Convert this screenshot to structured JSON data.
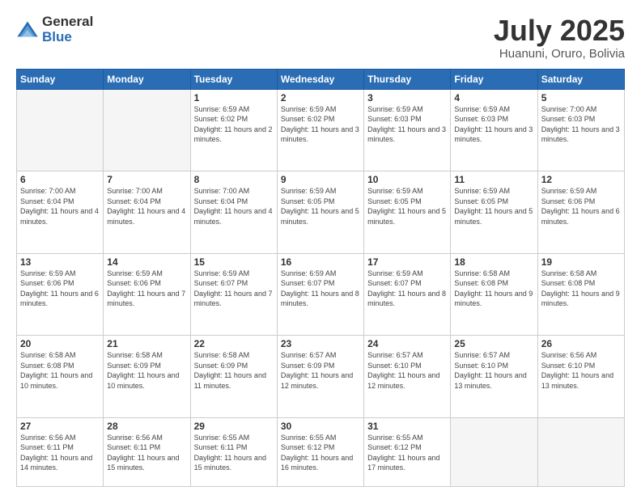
{
  "logo": {
    "general": "General",
    "blue": "Blue"
  },
  "title": "July 2025",
  "subtitle": "Huanuni, Oruro, Bolivia",
  "days_of_week": [
    "Sunday",
    "Monday",
    "Tuesday",
    "Wednesday",
    "Thursday",
    "Friday",
    "Saturday"
  ],
  "weeks": [
    [
      {
        "day": "",
        "sunrise": "",
        "sunset": "",
        "daylight": "",
        "empty": true
      },
      {
        "day": "",
        "sunrise": "",
        "sunset": "",
        "daylight": "",
        "empty": true
      },
      {
        "day": "1",
        "sunrise": "Sunrise: 6:59 AM",
        "sunset": "Sunset: 6:02 PM",
        "daylight": "Daylight: 11 hours and 2 minutes.",
        "empty": false
      },
      {
        "day": "2",
        "sunrise": "Sunrise: 6:59 AM",
        "sunset": "Sunset: 6:02 PM",
        "daylight": "Daylight: 11 hours and 3 minutes.",
        "empty": false
      },
      {
        "day": "3",
        "sunrise": "Sunrise: 6:59 AM",
        "sunset": "Sunset: 6:03 PM",
        "daylight": "Daylight: 11 hours and 3 minutes.",
        "empty": false
      },
      {
        "day": "4",
        "sunrise": "Sunrise: 6:59 AM",
        "sunset": "Sunset: 6:03 PM",
        "daylight": "Daylight: 11 hours and 3 minutes.",
        "empty": false
      },
      {
        "day": "5",
        "sunrise": "Sunrise: 7:00 AM",
        "sunset": "Sunset: 6:03 PM",
        "daylight": "Daylight: 11 hours and 3 minutes.",
        "empty": false
      }
    ],
    [
      {
        "day": "6",
        "sunrise": "Sunrise: 7:00 AM",
        "sunset": "Sunset: 6:04 PM",
        "daylight": "Daylight: 11 hours and 4 minutes.",
        "empty": false
      },
      {
        "day": "7",
        "sunrise": "Sunrise: 7:00 AM",
        "sunset": "Sunset: 6:04 PM",
        "daylight": "Daylight: 11 hours and 4 minutes.",
        "empty": false
      },
      {
        "day": "8",
        "sunrise": "Sunrise: 7:00 AM",
        "sunset": "Sunset: 6:04 PM",
        "daylight": "Daylight: 11 hours and 4 minutes.",
        "empty": false
      },
      {
        "day": "9",
        "sunrise": "Sunrise: 6:59 AM",
        "sunset": "Sunset: 6:05 PM",
        "daylight": "Daylight: 11 hours and 5 minutes.",
        "empty": false
      },
      {
        "day": "10",
        "sunrise": "Sunrise: 6:59 AM",
        "sunset": "Sunset: 6:05 PM",
        "daylight": "Daylight: 11 hours and 5 minutes.",
        "empty": false
      },
      {
        "day": "11",
        "sunrise": "Sunrise: 6:59 AM",
        "sunset": "Sunset: 6:05 PM",
        "daylight": "Daylight: 11 hours and 5 minutes.",
        "empty": false
      },
      {
        "day": "12",
        "sunrise": "Sunrise: 6:59 AM",
        "sunset": "Sunset: 6:06 PM",
        "daylight": "Daylight: 11 hours and 6 minutes.",
        "empty": false
      }
    ],
    [
      {
        "day": "13",
        "sunrise": "Sunrise: 6:59 AM",
        "sunset": "Sunset: 6:06 PM",
        "daylight": "Daylight: 11 hours and 6 minutes.",
        "empty": false
      },
      {
        "day": "14",
        "sunrise": "Sunrise: 6:59 AM",
        "sunset": "Sunset: 6:06 PM",
        "daylight": "Daylight: 11 hours and 7 minutes.",
        "empty": false
      },
      {
        "day": "15",
        "sunrise": "Sunrise: 6:59 AM",
        "sunset": "Sunset: 6:07 PM",
        "daylight": "Daylight: 11 hours and 7 minutes.",
        "empty": false
      },
      {
        "day": "16",
        "sunrise": "Sunrise: 6:59 AM",
        "sunset": "Sunset: 6:07 PM",
        "daylight": "Daylight: 11 hours and 8 minutes.",
        "empty": false
      },
      {
        "day": "17",
        "sunrise": "Sunrise: 6:59 AM",
        "sunset": "Sunset: 6:07 PM",
        "daylight": "Daylight: 11 hours and 8 minutes.",
        "empty": false
      },
      {
        "day": "18",
        "sunrise": "Sunrise: 6:58 AM",
        "sunset": "Sunset: 6:08 PM",
        "daylight": "Daylight: 11 hours and 9 minutes.",
        "empty": false
      },
      {
        "day": "19",
        "sunrise": "Sunrise: 6:58 AM",
        "sunset": "Sunset: 6:08 PM",
        "daylight": "Daylight: 11 hours and 9 minutes.",
        "empty": false
      }
    ],
    [
      {
        "day": "20",
        "sunrise": "Sunrise: 6:58 AM",
        "sunset": "Sunset: 6:08 PM",
        "daylight": "Daylight: 11 hours and 10 minutes.",
        "empty": false
      },
      {
        "day": "21",
        "sunrise": "Sunrise: 6:58 AM",
        "sunset": "Sunset: 6:09 PM",
        "daylight": "Daylight: 11 hours and 10 minutes.",
        "empty": false
      },
      {
        "day": "22",
        "sunrise": "Sunrise: 6:58 AM",
        "sunset": "Sunset: 6:09 PM",
        "daylight": "Daylight: 11 hours and 11 minutes.",
        "empty": false
      },
      {
        "day": "23",
        "sunrise": "Sunrise: 6:57 AM",
        "sunset": "Sunset: 6:09 PM",
        "daylight": "Daylight: 11 hours and 12 minutes.",
        "empty": false
      },
      {
        "day": "24",
        "sunrise": "Sunrise: 6:57 AM",
        "sunset": "Sunset: 6:10 PM",
        "daylight": "Daylight: 11 hours and 12 minutes.",
        "empty": false
      },
      {
        "day": "25",
        "sunrise": "Sunrise: 6:57 AM",
        "sunset": "Sunset: 6:10 PM",
        "daylight": "Daylight: 11 hours and 13 minutes.",
        "empty": false
      },
      {
        "day": "26",
        "sunrise": "Sunrise: 6:56 AM",
        "sunset": "Sunset: 6:10 PM",
        "daylight": "Daylight: 11 hours and 13 minutes.",
        "empty": false
      }
    ],
    [
      {
        "day": "27",
        "sunrise": "Sunrise: 6:56 AM",
        "sunset": "Sunset: 6:11 PM",
        "daylight": "Daylight: 11 hours and 14 minutes.",
        "empty": false
      },
      {
        "day": "28",
        "sunrise": "Sunrise: 6:56 AM",
        "sunset": "Sunset: 6:11 PM",
        "daylight": "Daylight: 11 hours and 15 minutes.",
        "empty": false
      },
      {
        "day": "29",
        "sunrise": "Sunrise: 6:55 AM",
        "sunset": "Sunset: 6:11 PM",
        "daylight": "Daylight: 11 hours and 15 minutes.",
        "empty": false
      },
      {
        "day": "30",
        "sunrise": "Sunrise: 6:55 AM",
        "sunset": "Sunset: 6:12 PM",
        "daylight": "Daylight: 11 hours and 16 minutes.",
        "empty": false
      },
      {
        "day": "31",
        "sunrise": "Sunrise: 6:55 AM",
        "sunset": "Sunset: 6:12 PM",
        "daylight": "Daylight: 11 hours and 17 minutes.",
        "empty": false
      },
      {
        "day": "",
        "sunrise": "",
        "sunset": "",
        "daylight": "",
        "empty": true
      },
      {
        "day": "",
        "sunrise": "",
        "sunset": "",
        "daylight": "",
        "empty": true
      }
    ]
  ]
}
